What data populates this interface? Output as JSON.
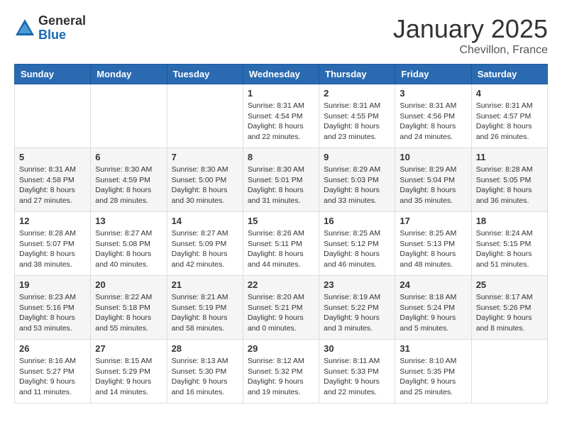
{
  "header": {
    "logo_general": "General",
    "logo_blue": "Blue",
    "month": "January 2025",
    "location": "Chevillon, France"
  },
  "weekdays": [
    "Sunday",
    "Monday",
    "Tuesday",
    "Wednesday",
    "Thursday",
    "Friday",
    "Saturday"
  ],
  "weeks": [
    [
      {
        "day": "",
        "info": ""
      },
      {
        "day": "",
        "info": ""
      },
      {
        "day": "",
        "info": ""
      },
      {
        "day": "1",
        "info": "Sunrise: 8:31 AM\nSunset: 4:54 PM\nDaylight: 8 hours\nand 22 minutes."
      },
      {
        "day": "2",
        "info": "Sunrise: 8:31 AM\nSunset: 4:55 PM\nDaylight: 8 hours\nand 23 minutes."
      },
      {
        "day": "3",
        "info": "Sunrise: 8:31 AM\nSunset: 4:56 PM\nDaylight: 8 hours\nand 24 minutes."
      },
      {
        "day": "4",
        "info": "Sunrise: 8:31 AM\nSunset: 4:57 PM\nDaylight: 8 hours\nand 26 minutes."
      }
    ],
    [
      {
        "day": "5",
        "info": "Sunrise: 8:31 AM\nSunset: 4:58 PM\nDaylight: 8 hours\nand 27 minutes."
      },
      {
        "day": "6",
        "info": "Sunrise: 8:30 AM\nSunset: 4:59 PM\nDaylight: 8 hours\nand 28 minutes."
      },
      {
        "day": "7",
        "info": "Sunrise: 8:30 AM\nSunset: 5:00 PM\nDaylight: 8 hours\nand 30 minutes."
      },
      {
        "day": "8",
        "info": "Sunrise: 8:30 AM\nSunset: 5:01 PM\nDaylight: 8 hours\nand 31 minutes."
      },
      {
        "day": "9",
        "info": "Sunrise: 8:29 AM\nSunset: 5:03 PM\nDaylight: 8 hours\nand 33 minutes."
      },
      {
        "day": "10",
        "info": "Sunrise: 8:29 AM\nSunset: 5:04 PM\nDaylight: 8 hours\nand 35 minutes."
      },
      {
        "day": "11",
        "info": "Sunrise: 8:28 AM\nSunset: 5:05 PM\nDaylight: 8 hours\nand 36 minutes."
      }
    ],
    [
      {
        "day": "12",
        "info": "Sunrise: 8:28 AM\nSunset: 5:07 PM\nDaylight: 8 hours\nand 38 minutes."
      },
      {
        "day": "13",
        "info": "Sunrise: 8:27 AM\nSunset: 5:08 PM\nDaylight: 8 hours\nand 40 minutes."
      },
      {
        "day": "14",
        "info": "Sunrise: 8:27 AM\nSunset: 5:09 PM\nDaylight: 8 hours\nand 42 minutes."
      },
      {
        "day": "15",
        "info": "Sunrise: 8:26 AM\nSunset: 5:11 PM\nDaylight: 8 hours\nand 44 minutes."
      },
      {
        "day": "16",
        "info": "Sunrise: 8:25 AM\nSunset: 5:12 PM\nDaylight: 8 hours\nand 46 minutes."
      },
      {
        "day": "17",
        "info": "Sunrise: 8:25 AM\nSunset: 5:13 PM\nDaylight: 8 hours\nand 48 minutes."
      },
      {
        "day": "18",
        "info": "Sunrise: 8:24 AM\nSunset: 5:15 PM\nDaylight: 8 hours\nand 51 minutes."
      }
    ],
    [
      {
        "day": "19",
        "info": "Sunrise: 8:23 AM\nSunset: 5:16 PM\nDaylight: 8 hours\nand 53 minutes."
      },
      {
        "day": "20",
        "info": "Sunrise: 8:22 AM\nSunset: 5:18 PM\nDaylight: 8 hours\nand 55 minutes."
      },
      {
        "day": "21",
        "info": "Sunrise: 8:21 AM\nSunset: 5:19 PM\nDaylight: 8 hours\nand 58 minutes."
      },
      {
        "day": "22",
        "info": "Sunrise: 8:20 AM\nSunset: 5:21 PM\nDaylight: 9 hours\nand 0 minutes."
      },
      {
        "day": "23",
        "info": "Sunrise: 8:19 AM\nSunset: 5:22 PM\nDaylight: 9 hours\nand 3 minutes."
      },
      {
        "day": "24",
        "info": "Sunrise: 8:18 AM\nSunset: 5:24 PM\nDaylight: 9 hours\nand 5 minutes."
      },
      {
        "day": "25",
        "info": "Sunrise: 8:17 AM\nSunset: 5:26 PM\nDaylight: 9 hours\nand 8 minutes."
      }
    ],
    [
      {
        "day": "26",
        "info": "Sunrise: 8:16 AM\nSunset: 5:27 PM\nDaylight: 9 hours\nand 11 minutes."
      },
      {
        "day": "27",
        "info": "Sunrise: 8:15 AM\nSunset: 5:29 PM\nDaylight: 9 hours\nand 14 minutes."
      },
      {
        "day": "28",
        "info": "Sunrise: 8:13 AM\nSunset: 5:30 PM\nDaylight: 9 hours\nand 16 minutes."
      },
      {
        "day": "29",
        "info": "Sunrise: 8:12 AM\nSunset: 5:32 PM\nDaylight: 9 hours\nand 19 minutes."
      },
      {
        "day": "30",
        "info": "Sunrise: 8:11 AM\nSunset: 5:33 PM\nDaylight: 9 hours\nand 22 minutes."
      },
      {
        "day": "31",
        "info": "Sunrise: 8:10 AM\nSunset: 5:35 PM\nDaylight: 9 hours\nand 25 minutes."
      },
      {
        "day": "",
        "info": ""
      }
    ]
  ]
}
